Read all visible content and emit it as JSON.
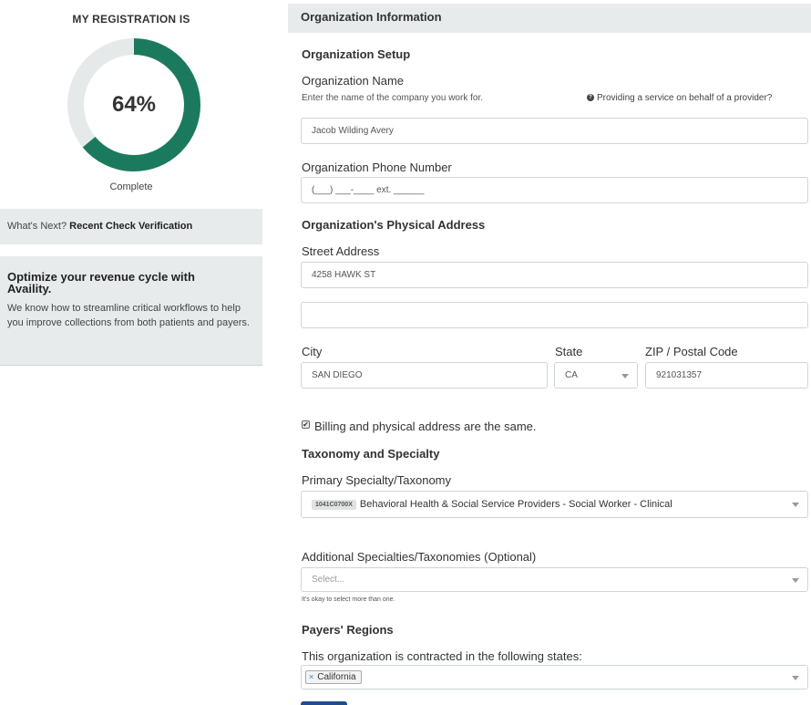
{
  "sidebar": {
    "progress": {
      "heading": "MY REGISTRATION IS",
      "value_label": "64%",
      "fraction": 0.64,
      "sub_label": "Complete"
    },
    "next": {
      "prefix": "What's Next?",
      "item": "Recent Check Verification"
    },
    "promo": {
      "title": "Optimize your revenue cycle with Availity.",
      "body": "We know how to streamline critical workflows to help you improve collections from both patients and payers."
    }
  },
  "main": {
    "section_title": "Organization Information",
    "org_setup": {
      "heading": "Organization Setup",
      "name_label": "Organization Name",
      "name_help": "Enter the name of the company you work for.",
      "provider_link": "Providing a service on behalf of a provider?",
      "name_value": "Jacob Wilding Avery",
      "phone_label": "Organization Phone Number",
      "phone_value": "(___) ___-____ ext. ______"
    },
    "address": {
      "heading": "Organization's Physical Address",
      "street_label": "Street Address",
      "street_value": "4258 HAWK ST",
      "street2_value": "",
      "city_label": "City",
      "city_value": "SAN DIEGO",
      "state_label": "State",
      "state_value": "CA",
      "zip_label": "ZIP / Postal Code",
      "zip_value": "921031357",
      "billing_same_label": "Billing and physical address are the same.",
      "billing_same_checked": true
    },
    "taxonomy": {
      "heading": "Taxonomy and Specialty",
      "primary_label": "Primary Specialty/Taxonomy",
      "primary_code": "1041C0700X",
      "primary_value": "Behavioral Health & Social Service Providers - Social Worker - Clinical",
      "additional_label": "Additional Specialties/Taxonomies (Optional)",
      "additional_placeholder": "Select...",
      "additional_help": "It's okay to select more than one."
    },
    "regions": {
      "heading": "Payers' Regions",
      "states_label": "This organization is contracted in the following states:",
      "states": [
        "California"
      ]
    }
  },
  "colors": {
    "progress_fill": "#1b7a5e",
    "progress_track": "#e6e9ea",
    "panel_bg": "#e7ebec",
    "button": "#1f4e8c"
  },
  "icons": {
    "help": "question-circle-icon",
    "caret": "chevron-down-icon",
    "chip_remove": "close-icon",
    "checkbox": "checkbox-checked-icon"
  }
}
